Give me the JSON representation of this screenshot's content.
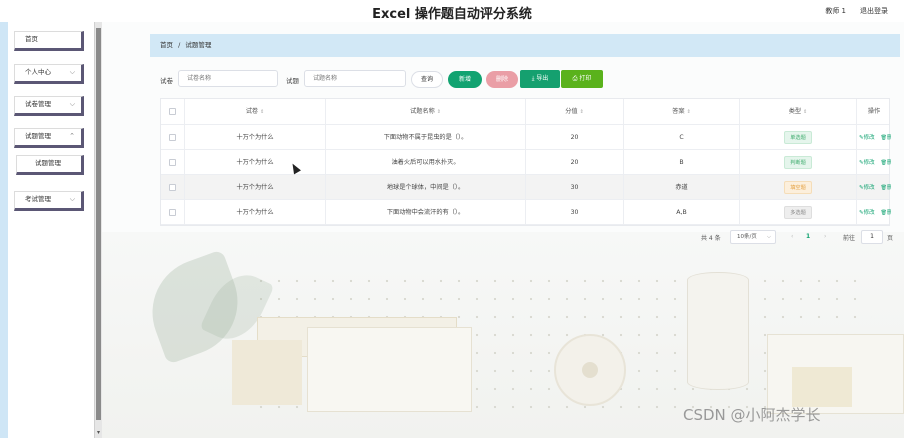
{
  "header": {
    "title": "Excel 操作题自动评分系统",
    "user": "教师 1",
    "logout": "退出登录"
  },
  "sidebar": {
    "items": [
      {
        "label": "首页",
        "has_chevron": false
      },
      {
        "label": "个人中心",
        "has_chevron": true
      },
      {
        "label": "试卷管理",
        "has_chevron": true
      },
      {
        "label": "试题管理",
        "has_chevron": true
      },
      {
        "label": "试题管理",
        "has_chevron": false
      },
      {
        "label": "考试管理",
        "has_chevron": true
      }
    ]
  },
  "breadcrumb": {
    "home": "首页",
    "separator": "/",
    "current": "试题管理"
  },
  "search": {
    "label1": "试卷",
    "placeholder1": "试卷名称",
    "label2": "试题",
    "placeholder2": "试题名称",
    "search_btn": "查询",
    "add_btn": "新增",
    "delete_btn": "删除",
    "export_btn": "导出",
    "print_btn": "打印"
  },
  "table": {
    "headers": [
      "试卷",
      "试题名称",
      "分值",
      "答案",
      "类型",
      "操作"
    ],
    "rows": [
      {
        "paper": "十万个为什么",
        "question": "下面动物不属于昆虫的是（）。",
        "score": "20",
        "answer": "C",
        "type": "单选题",
        "type_style": "single"
      },
      {
        "paper": "十万个为什么",
        "question": "油着火后可以用水扑灭。",
        "score": "20",
        "answer": "B",
        "type": "判断题",
        "type_style": "judge"
      },
      {
        "paper": "十万个为什么",
        "question": "地球是个球体，中间是（）。",
        "score": "30",
        "answer": "赤道",
        "type": "填空题",
        "type_style": "fill"
      },
      {
        "paper": "十万个为什么",
        "question": "下面动物中会流汗的有（）。",
        "score": "30",
        "answer": "A,B",
        "type": "多选题",
        "type_style": "multi"
      }
    ],
    "edit_label": "修改",
    "delete_label": "删除"
  },
  "pager": {
    "total": "共 4 条",
    "page_size": "10条/页",
    "current_page": "1",
    "goto_label": "前往",
    "goto_value": "1",
    "page_unit": "页"
  },
  "watermark": "CSDN @小阿杰学长",
  "colors": {
    "accent": "#12a371",
    "breadcrumb_bg": "#d2e8f6",
    "danger_light": "#ea9ea6",
    "print": "#5ab21c"
  }
}
